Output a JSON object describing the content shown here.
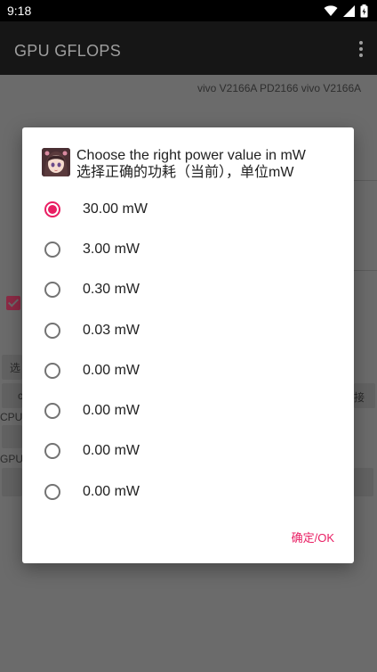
{
  "status_bar": {
    "time": "9:18",
    "icons": [
      "wifi-icon",
      "signal-icon",
      "battery-charging-icon"
    ]
  },
  "app_bar": {
    "title": "GPU GFLOPS",
    "menu_icon": "more-vert-icon"
  },
  "background": {
    "device_info": "vivo V2166A PD2166 vivo V2166A",
    "partial_texts": {
      "select": "选",
      "cpu": "CPU",
      "gpu": "GPU",
      "button_left": "c",
      "button_right": "接"
    }
  },
  "dialog": {
    "title_en": "Choose the right power value in mW",
    "title_zh": "选择正确的功耗（当前），单位mW",
    "options": [
      {
        "label": "30.00 mW",
        "selected": true
      },
      {
        "label": "3.00 mW",
        "selected": false
      },
      {
        "label": "0.30 mW",
        "selected": false
      },
      {
        "label": "0.03 mW",
        "selected": false
      },
      {
        "label": "0.00 mW",
        "selected": false
      },
      {
        "label": "0.00 mW",
        "selected": false
      },
      {
        "label": "0.00 mW",
        "selected": false
      },
      {
        "label": "0.00 mW",
        "selected": false
      }
    ],
    "ok_label": "确定/OK"
  },
  "colors": {
    "accent": "#e91e63",
    "scrim": "#6b6b6b",
    "status_bar": "#000000"
  }
}
